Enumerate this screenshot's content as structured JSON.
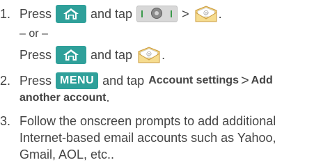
{
  "steps": {
    "s1": {
      "num": "1.",
      "press": "Press",
      "and_tap": "and tap",
      "gt": ">",
      "end": "."
    },
    "or_text": "– or –",
    "alt": {
      "press": "Press",
      "and_tap": "and tap",
      "end": "."
    },
    "s2": {
      "num": "2.",
      "press": "Press",
      "menu_key": "MENU",
      "and_tap": "and tap",
      "account_settings": "Account settings",
      "gt": ">",
      "add": "Add",
      "another_account": "another account",
      "end": "."
    },
    "s3": {
      "num": "3.",
      "line1": "Follow the onscreen prompts to add additional",
      "line2": "Internet-based email accounts such as Yahoo,",
      "line3": "Gmail, AOL, etc.."
    }
  },
  "icons": {
    "home_key": "home-key-icon",
    "launcher": "launcher-bar-icon",
    "email": "email-envelope-icon"
  },
  "colors": {
    "key_teal": "#2fa09a",
    "text": "#444444",
    "envelope_yellow": "#f3d27a"
  }
}
